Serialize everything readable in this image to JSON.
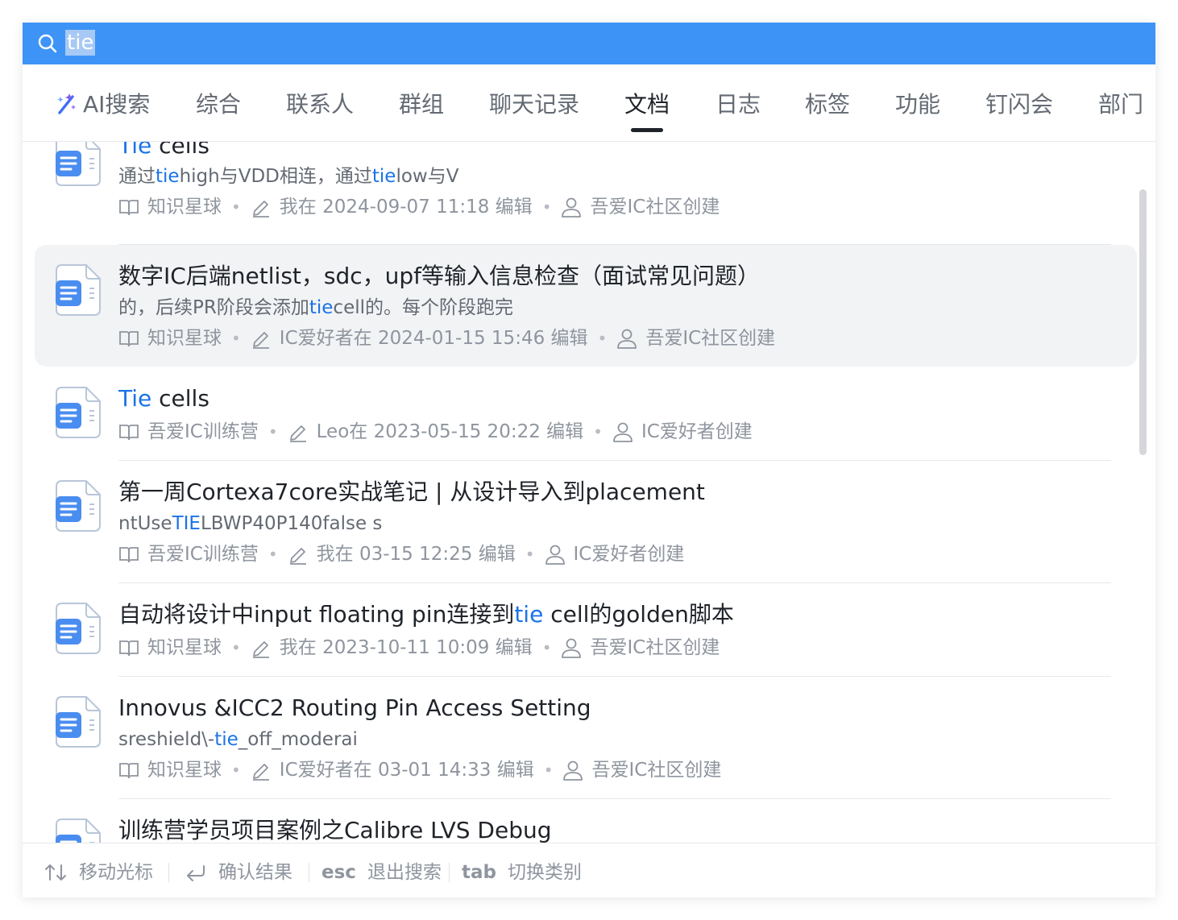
{
  "search": {
    "query": "tie"
  },
  "tabs": [
    {
      "label": "AI搜索"
    },
    {
      "label": "综合"
    },
    {
      "label": "联系人"
    },
    {
      "label": "群组"
    },
    {
      "label": "聊天记录"
    },
    {
      "label": "文档",
      "active": true
    },
    {
      "label": "日志"
    },
    {
      "label": "标签"
    },
    {
      "label": "功能"
    },
    {
      "label": "钉闪会"
    },
    {
      "label": "部门"
    }
  ],
  "results": [
    {
      "title_hit": "Tie",
      "title_rest": " cells",
      "snippet": {
        "a": "通过",
        "b": "tie",
        "c": "high与VDD相连，通过",
        "d": "tie",
        "e": "low与V"
      },
      "source": "知识星球",
      "edited": "我在 2024-09-07 11:18 编辑",
      "creator": "吾爱IC社区创建"
    },
    {
      "title": "数字IC后端netlist，sdc，upf等输入信息检查（面试常见问题）",
      "snippet": {
        "a": "的，后续PR阶段会添加",
        "b": "tie",
        "c": "cell的。每个阶段跑完"
      },
      "source": "知识星球",
      "edited": "IC爱好者在 2024-01-15 15:46 编辑",
      "creator": "吾爱IC社区创建"
    },
    {
      "title_hit": "Tie",
      "title_rest": " cells",
      "source": "吾爱IC训练营",
      "edited": "Leo在 2023-05-15 20:22 编辑",
      "creator": "IC爱好者创建"
    },
    {
      "title": "第一周Cortexa7core实战笔记 | 从设计导入到placement",
      "snippet": {
        "a": "ntUse",
        "b": "TIE",
        "c": "LBWP40P140false s"
      },
      "source": "吾爱IC训练营",
      "edited": "我在 03-15 12:25 编辑",
      "creator": "IC爱好者创建"
    },
    {
      "title_a": "自动将设计中input floating pin连接到",
      "title_hit": "tie",
      "title_c": " cell的golden脚本",
      "source": "知识星球",
      "edited": "我在 2023-10-11 10:09 编辑",
      "creator": "吾爱IC社区创建"
    },
    {
      "title": "Innovus &ICC2 Routing Pin Access Setting",
      "snippet": {
        "a": "sreshield\\-",
        "b": "tie",
        "c": "_off_moderai"
      },
      "source": "知识星球",
      "edited": "IC爱好者在 03-01 14:33 编辑",
      "creator": "吾爱IC社区创建"
    },
    {
      "title": "训练营学员项目案例之Calibre LVS Debug"
    }
  ],
  "footer": [
    {
      "label": "移动光标"
    },
    {
      "label": "确认结果"
    },
    {
      "key": "esc",
      "label": "退出搜索"
    },
    {
      "key": "tab",
      "label": "切换类别"
    }
  ],
  "colors": {
    "search_bar": "#3d94f6",
    "highlight": "#1a73e8",
    "doc_icon": "#4a8df0"
  }
}
